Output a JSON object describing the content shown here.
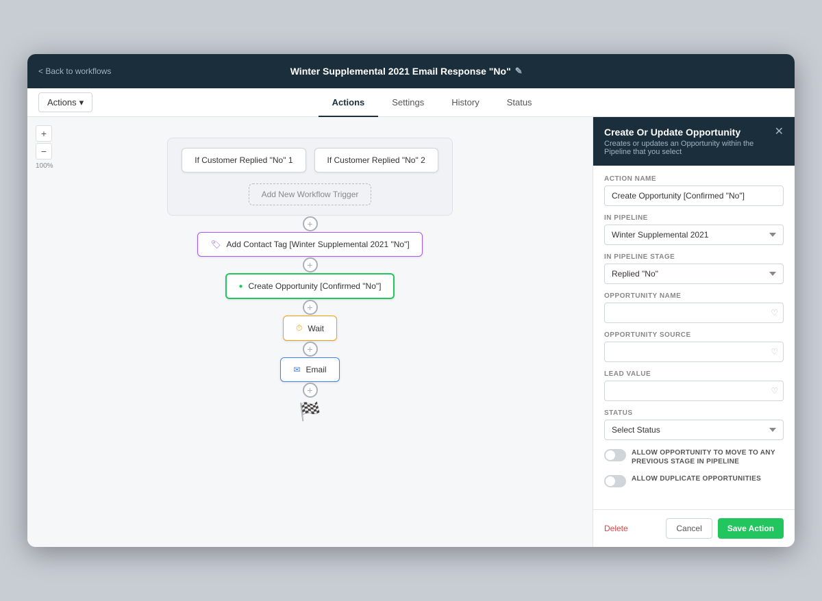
{
  "topbar": {
    "back_label": "< Back to workflows",
    "title": "Winter Supplemental 2021 Email Response \"No\"",
    "edit_icon": "✎"
  },
  "tabs": {
    "actions_dropdown": "Actions",
    "items": [
      {
        "label": "Actions",
        "active": true
      },
      {
        "label": "Settings",
        "active": false
      },
      {
        "label": "History",
        "active": false
      },
      {
        "label": "Status",
        "active": false
      }
    ]
  },
  "canvas": {
    "zoom_label": "100%",
    "zoom_in": "+",
    "zoom_out": "−",
    "triggers": {
      "box1": "If Customer Replied \"No\" 1",
      "box2": "If Customer Replied \"No\" 2",
      "add_trigger": "Add New Workflow Trigger"
    },
    "nodes": [
      {
        "id": "tag-node",
        "type": "tag",
        "label": "Add Contact Tag [Winter Supplemental 2021 \"No\"]",
        "icon": "🏷"
      },
      {
        "id": "opportunity-node",
        "type": "opportunity",
        "label": "Create Opportunity [Confirmed \"No\"]",
        "icon": "●"
      },
      {
        "id": "wait-node",
        "type": "wait",
        "label": "Wait",
        "icon": "⏱"
      },
      {
        "id": "email-node",
        "type": "email",
        "label": "Email",
        "icon": "✉"
      }
    ],
    "finish_icon": "🏁"
  },
  "panel": {
    "title": "Create Or Update Opportunity",
    "subtitle": "Creates or updates an Opportunity within the Pipeline that you select",
    "close_icon": "✕",
    "fields": {
      "action_name_label": "ACTION NAME",
      "action_name_value": "Create Opportunity [Confirmed \"No\"]",
      "in_pipeline_label": "IN PIPELINE",
      "in_pipeline_value": "Winter Supplemental 2021",
      "in_pipeline_stage_label": "IN PIPELINE STAGE",
      "in_pipeline_stage_value": "Replied \"No\"",
      "opportunity_name_label": "OPPORTUNITY NAME",
      "opportunity_name_placeholder": "",
      "opportunity_source_label": "OPPORTUNITY SOURCE",
      "opportunity_source_placeholder": "",
      "lead_value_label": "LEAD VALUE",
      "lead_value_placeholder": "",
      "status_label": "STATUS",
      "status_placeholder": "Select Status",
      "toggle1_label": "ALLOW OPPORTUNITY TO MOVE TO ANY PREVIOUS STAGE IN PIPELINE",
      "toggle2_label": "ALLOW DUPLICATE OPPORTUNITIES"
    },
    "footer": {
      "delete_label": "Delete",
      "cancel_label": "Cancel",
      "save_label": "Save Action"
    }
  }
}
